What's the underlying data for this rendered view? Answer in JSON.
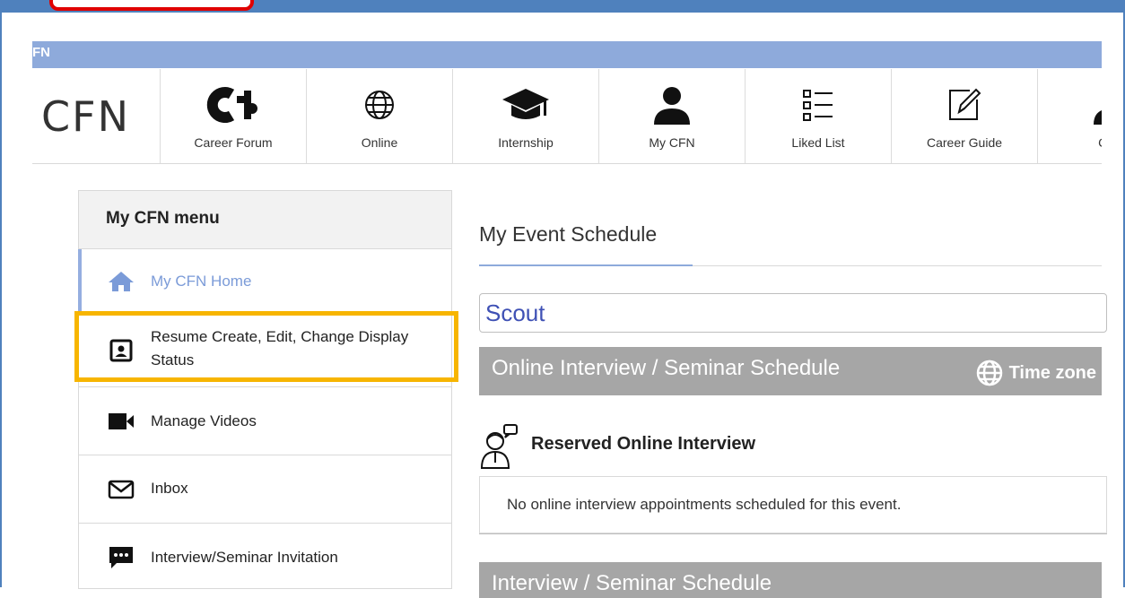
{
  "window": {
    "title_fragment": "FN"
  },
  "brand": {
    "text": "CFN"
  },
  "nav": {
    "items": [
      {
        "label": "Career Forum",
        "icon": "career-forum-logo-icon"
      },
      {
        "label": "Online",
        "icon": "globe-icon"
      },
      {
        "label": "Internship",
        "icon": "graduation-cap-icon"
      },
      {
        "label": "My CFN",
        "icon": "person-icon"
      },
      {
        "label": "Liked List",
        "icon": "list-icon"
      },
      {
        "label": "Career Guide",
        "icon": "pencil-note-icon"
      },
      {
        "label": "CFN",
        "icon": "person-icon"
      }
    ]
  },
  "menu": {
    "heading": "My CFN menu",
    "items": [
      {
        "label": "My CFN Home",
        "icon": "home-icon",
        "active": true
      },
      {
        "label": "Resume Create, Edit, Change Display Status",
        "icon": "resume-card-icon",
        "highlighted": true
      },
      {
        "label": "Manage Videos",
        "icon": "video-camera-icon"
      },
      {
        "label": "Inbox",
        "icon": "envelope-icon"
      },
      {
        "label": "Interview/Seminar Invitation",
        "icon": "chat-bubble-icon"
      }
    ]
  },
  "main": {
    "title": "My Event Schedule",
    "scout": "Scout",
    "online_schedule": "Online Interview / Seminar Schedule",
    "time_zone": "Time zone",
    "reserved_title": "Reserved Online Interview",
    "no_appointments": "No online interview appointments scheduled for this event.",
    "schedule_title": "Interview / Seminar Schedule"
  },
  "colors": {
    "frame": "#4f81bd",
    "title_bar": "#8eaadb",
    "highlight": "#f7b500",
    "callout": "#e00000",
    "section_bar": "#a6a6a6",
    "scout_text": "#3f51b5",
    "home_active": "#95aee0"
  }
}
